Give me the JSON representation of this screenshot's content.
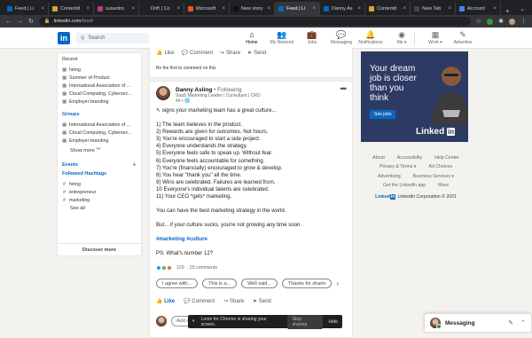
{
  "browser": {
    "tabs": [
      {
        "label": "Feed | Li",
        "color": "#0a66c2",
        "active": false
      },
      {
        "label": "Contentd",
        "color": "#e1a03b",
        "active": false
      },
      {
        "label": "susantro",
        "color": "#c13584",
        "active": false
      },
      {
        "label": "Drift | Co",
        "color": "#222222",
        "active": false
      },
      {
        "label": "Microsoft",
        "color": "#f25022",
        "active": false
      },
      {
        "label": "New story",
        "color": "#111111",
        "active": false
      },
      {
        "label": "Feed | Li",
        "color": "#0a66c2",
        "active": true
      },
      {
        "label": "Danny As",
        "color": "#0a66c2",
        "active": false
      },
      {
        "label": "Contentd",
        "color": "#e1a03b",
        "active": false
      },
      {
        "label": "New Tab",
        "color": "#444444",
        "active": false
      },
      {
        "label": "Account",
        "color": "#4285f4",
        "active": false
      }
    ],
    "url_host": "linkedin.com",
    "url_path": "/feed/"
  },
  "header": {
    "logo": "in",
    "search_placeholder": "Search",
    "nav": [
      {
        "label": "Home",
        "icon": "⌂",
        "active": true
      },
      {
        "label": "My Network",
        "icon": "👥",
        "active": false
      },
      {
        "label": "Jobs",
        "icon": "💼",
        "active": false
      },
      {
        "label": "Messaging",
        "icon": "💬",
        "active": false
      },
      {
        "label": "Notifications",
        "icon": "🔔",
        "active": false
      },
      {
        "label": "Me ▾",
        "icon": "◉",
        "active": false
      },
      {
        "label": "Work ▾",
        "icon": "▦",
        "active": false
      },
      {
        "label": "Advertise",
        "icon": "✎",
        "active": false
      }
    ]
  },
  "left": {
    "recent_title": "Recent",
    "recent": [
      "hiring",
      "Summer of Product",
      "International Association of ...",
      "Cloud Computing, Cybersec...",
      "Employer branding"
    ],
    "groups_title": "Groups",
    "groups": [
      "International Association of ...",
      "Cloud Computing, Cybersec...",
      "Employer branding"
    ],
    "show_more": "Show more ︾",
    "events_title": "Events",
    "events_plus": "+",
    "hashtags_title": "Followed Hashtags",
    "hashtags": [
      "hiring",
      "entrepreneur",
      "marketing"
    ],
    "see_all": "See all",
    "discover_more": "Discover more"
  },
  "feed_top": {
    "actions": [
      "Like",
      "Comment",
      "Share",
      "Send"
    ],
    "first_comment": "Be the first to comment on this"
  },
  "post": {
    "author": "Danny Asling",
    "follow": " • Following",
    "subtitle": "SaaS Marketing Leader | Consultant | CRO",
    "time": "4d • 🌐",
    "menu": "•••",
    "intro": "signs your marketing team has a great culture...",
    "list": [
      "1) The team believes in the product.",
      "2) Rewards are given for outcomes. Not hours.",
      "3) You're encouraged to start a side project.",
      "4) Everyone understands the strategy.",
      "5) Everyone feels safe to speak up. Without fear.",
      "6) Everyone feels accountable for something.",
      "7) You're (financially) encouraged to grow & develop.",
      "8) You hear \"thank you\" all the time.",
      "9) Wins are celebrated. Failures are learned from.",
      "10 Everyone's individual talents are celebrated.",
      "11) Your CEO *gets* marketing."
    ],
    "para1": "You can have the best marketing strategy in the world.",
    "para2": "But... if your culture sucks, you're not growing any time soon.",
    "tags": "#marketing #culture",
    "ps": "PS. What's number 12?",
    "reaction_count": "129",
    "comments_count": "· 20 comments",
    "pills": [
      "I agree with...",
      "This is a...",
      "Well said...",
      "Thanks for sharin"
    ],
    "actions": [
      "Like",
      "Comment",
      "Share",
      "Send"
    ],
    "comment_placeholder": "Add a"
  },
  "ad": {
    "headline": "Your dream job is closer than you think",
    "button": "See jobs",
    "logo_text": "Linked",
    "logo_in": "in"
  },
  "footer": {
    "row1": [
      "About",
      "Accessibility",
      "Help Center"
    ],
    "row2": [
      "Privacy & Terms ▾",
      "Ad Choices"
    ],
    "row3": [
      "Advertising",
      "Business Services ▾"
    ],
    "row4": [
      "Get the LinkedIn app",
      "More"
    ],
    "brand_prefix": "Linked",
    "brand_in": "in",
    "copyright": "LinkedIn Corporation © 2021"
  },
  "share_bar": {
    "text": "Loom for Chrome is sharing your screen.",
    "stop": "Stop sharing",
    "hide": "Hide"
  },
  "messaging": {
    "label": "Messaging",
    "icons": [
      "✎",
      "⌃"
    ]
  }
}
